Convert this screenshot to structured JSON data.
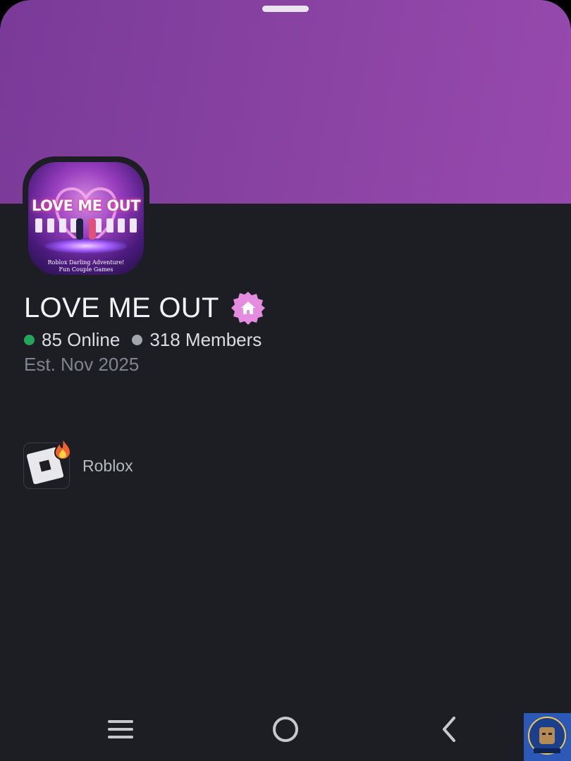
{
  "server": {
    "name": "LOVE ME OUT",
    "online_count": "85 Online",
    "member_count": "318 Members",
    "established": "Est. Nov 2025",
    "banner_color": "#8a43a3",
    "badge_icon": "home-badge-icon",
    "badge_color": "#e58ce0"
  },
  "server_icon": {
    "title": "LOVE ME OUT",
    "subtitle_line1": "Roblox Darling Adventure!",
    "subtitle_line2": "Fun Couple Games"
  },
  "status_colors": {
    "online": "#23a55a",
    "members": "#80848e"
  },
  "game": {
    "label": "Roblox",
    "icon": "roblox-icon",
    "activity_icon": "flame-icon"
  },
  "navigation": {
    "recents": "menu-icon",
    "home": "home-circle-icon",
    "back": "back-chevron-icon"
  }
}
